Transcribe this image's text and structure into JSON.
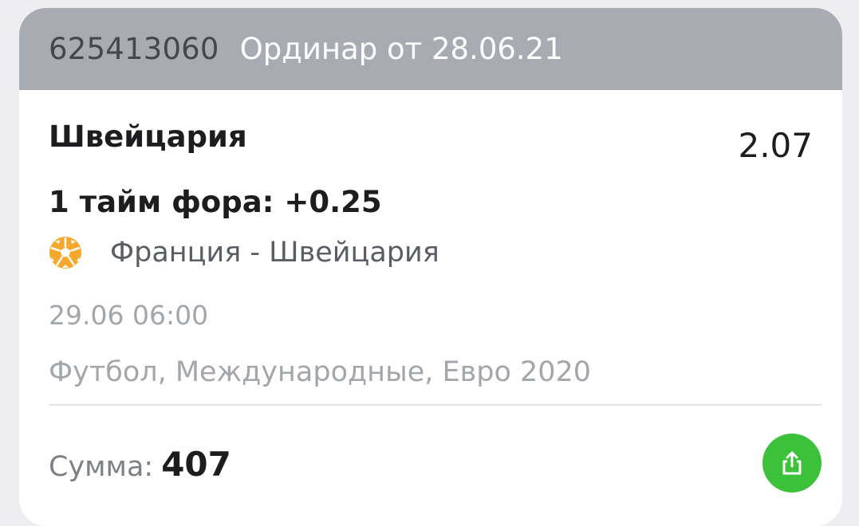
{
  "header": {
    "bet_id": "625413060",
    "bet_type": "Ординар от 28.06.21"
  },
  "bet": {
    "selection": "Швейцария",
    "odds": "2.07",
    "market": "1 тайм фора: +0.25",
    "sport_icon": "soccer-ball-icon",
    "match": "Франция - Швейцария",
    "datetime": "29.06 06:00",
    "league": "Футбол, Международные, Евро 2020"
  },
  "footer": {
    "sum_label": "Сумма:",
    "sum_value": "407",
    "share_icon": "share-icon"
  },
  "colors": {
    "header_bg": "#a8abb1",
    "accent_orange": "#f7a72b",
    "share_green": "#3cc13b"
  }
}
